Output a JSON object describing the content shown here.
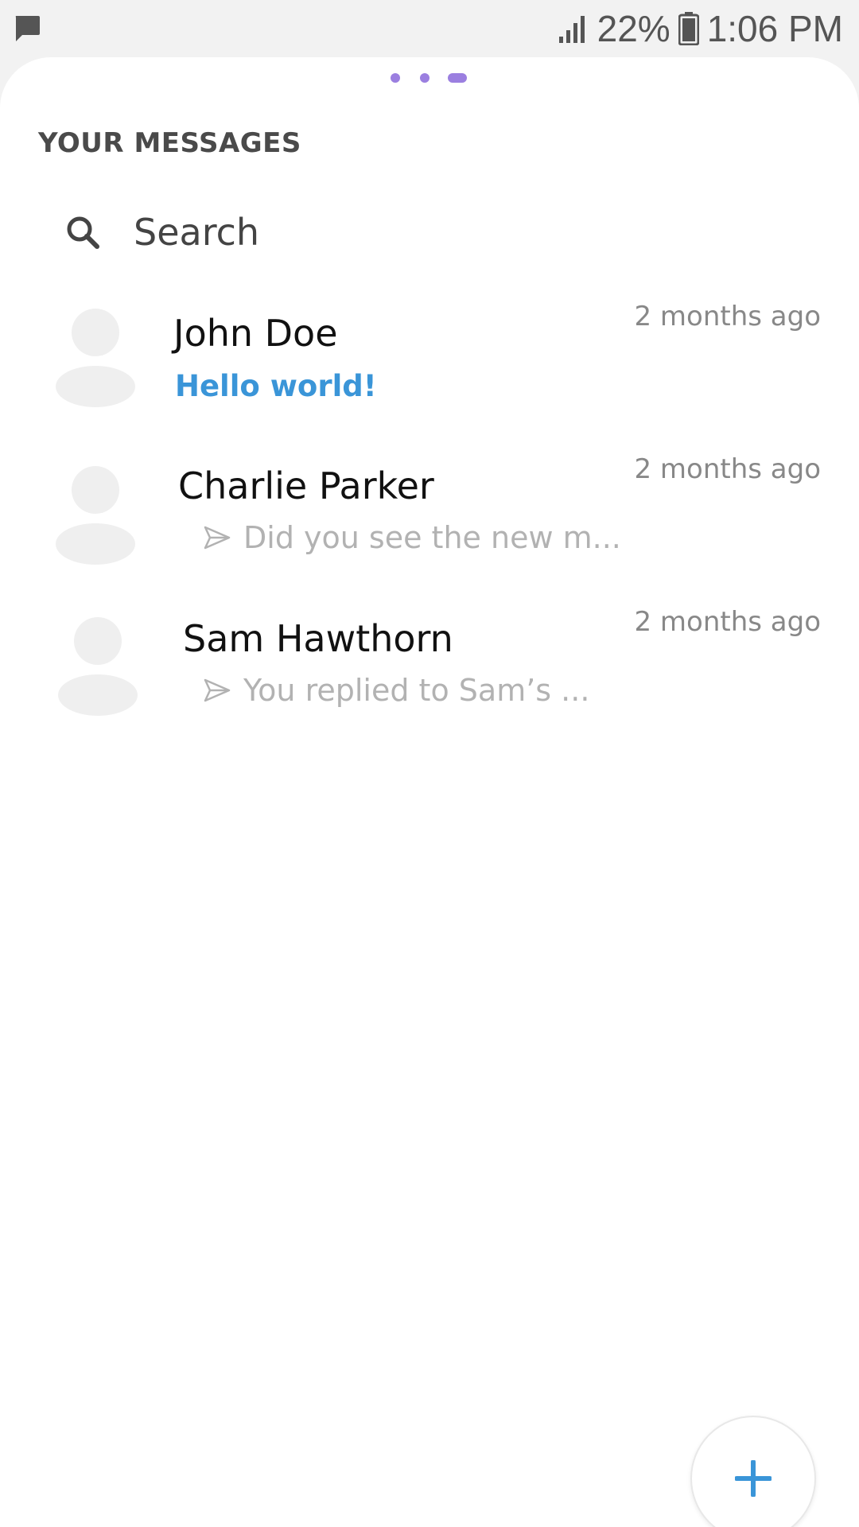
{
  "status_bar": {
    "battery": "22%",
    "time": "1:06 PM",
    "left_icon": "message-notification-icon"
  },
  "pager": {
    "count": 3,
    "active_index": 2,
    "color": "#9b7fe0"
  },
  "header": {
    "title": "YOUR MESSAGES"
  },
  "search": {
    "placeholder": "Search"
  },
  "conversations": [
    {
      "name": "John Doe",
      "preview": "Hello world!",
      "time": "2 months ago",
      "unread": true
    },
    {
      "name": "Charlie Parker",
      "preview": "Did you see the new m...",
      "time": "2 months ago",
      "unread": false
    },
    {
      "name": "Sam Hawthorn",
      "preview": "You replied to Sam’s ...",
      "time": "2 months ago",
      "unread": false
    }
  ],
  "fab": {
    "icon": "plus-icon",
    "accent": "#3a95d8"
  },
  "colors": {
    "accent": "#3a95d8",
    "avatar": "#efefef",
    "muted": "#b2b2b2"
  }
}
